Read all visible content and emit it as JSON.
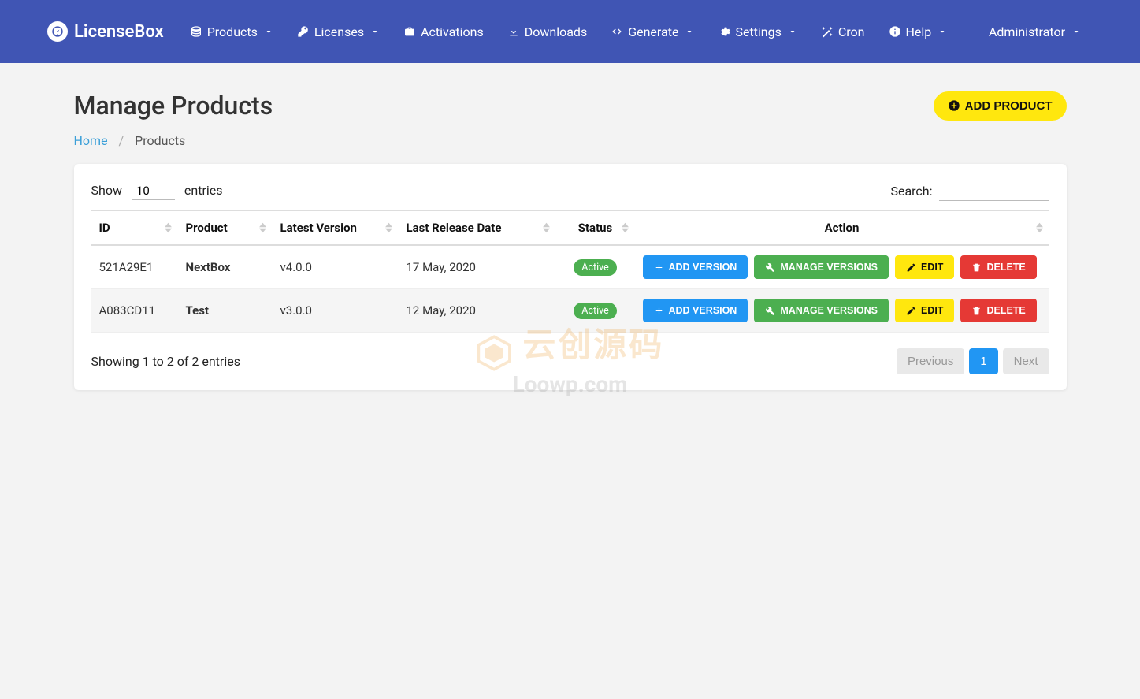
{
  "brand": "LicenseBox",
  "nav": {
    "items": [
      {
        "label": "Products",
        "icon": "database",
        "chevron": true
      },
      {
        "label": "Licenses",
        "icon": "key",
        "chevron": true
      },
      {
        "label": "Activations",
        "icon": "briefcase",
        "chevron": false
      },
      {
        "label": "Downloads",
        "icon": "download",
        "chevron": false
      },
      {
        "label": "Generate",
        "icon": "code",
        "chevron": true
      },
      {
        "label": "Settings",
        "icon": "gear",
        "chevron": true
      },
      {
        "label": "Cron",
        "icon": "wand",
        "chevron": false
      },
      {
        "label": "Help",
        "icon": "info",
        "chevron": true
      }
    ],
    "user": {
      "label": "Administrator",
      "chevron": true
    }
  },
  "page": {
    "title": "Manage Products",
    "add_button": "ADD PRODUCT"
  },
  "breadcrumb": {
    "home": "Home",
    "current": "Products"
  },
  "table": {
    "show_label_pre": "Show",
    "show_label_post": "entries",
    "entries_value": "10",
    "search_label": "Search:",
    "columns": [
      "ID",
      "Product",
      "Latest Version",
      "Last Release Date",
      "Status",
      "Action"
    ],
    "rows": [
      {
        "id": "521A29E1",
        "product": "NextBox",
        "version": "v4.0.0",
        "date": "17 May, 2020",
        "status": "Active"
      },
      {
        "id": "A083CD11",
        "product": "Test",
        "version": "v3.0.0",
        "date": "12 May, 2020",
        "status": "Active"
      }
    ],
    "actions": {
      "add_version": "ADD VERSION",
      "manage_versions": "MANAGE VERSIONS",
      "edit": "EDIT",
      "delete": "DELETE"
    },
    "footer_info": "Showing 1 to 2 of 2 entries",
    "pagination": {
      "previous": "Previous",
      "current": "1",
      "next": "Next"
    }
  },
  "watermark": {
    "cn": "云创源码",
    "en": "Loowp.com"
  }
}
